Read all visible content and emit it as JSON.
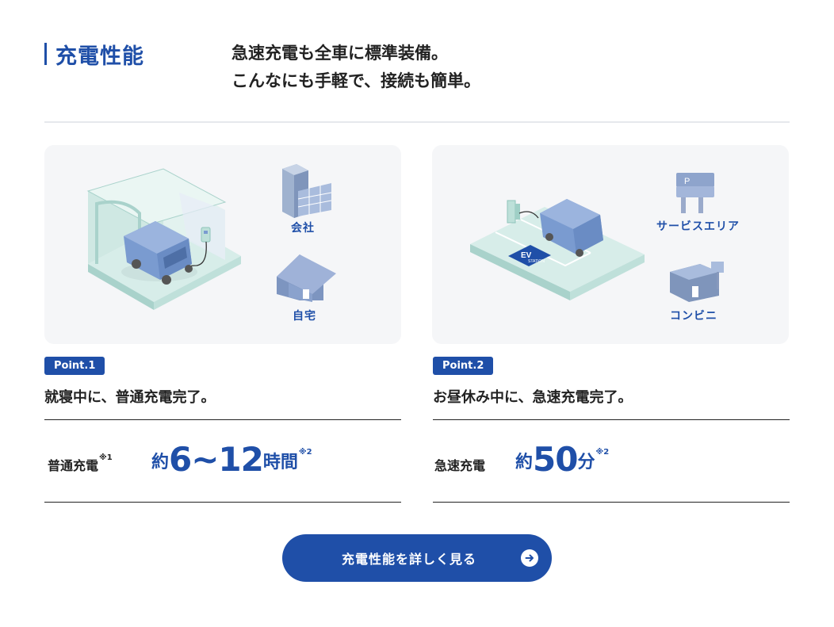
{
  "section": {
    "title": "充電性能",
    "lead_line1": "急速充電も全車に標準装備。",
    "lead_line2": "こんなにも手軽で、接続も簡単。"
  },
  "cards": [
    {
      "places": [
        "会社",
        "自宅"
      ],
      "point_badge": "Point.1",
      "description": "就寝中に、普通充電完了。",
      "charge_type": "普通充電",
      "charge_type_note": "※1",
      "value_prefix": "約",
      "value_number": "6~12",
      "value_unit": "時間",
      "value_note": "※2"
    },
    {
      "places": [
        "サービスエリア",
        "コンビニ"
      ],
      "point_badge": "Point.2",
      "description": "お昼休み中に、急速充電完了。",
      "charge_type": "急速充電",
      "charge_type_note": "",
      "value_prefix": "約",
      "value_number": "50",
      "value_unit": "分",
      "value_note": "※2"
    }
  ],
  "illustration_text": {
    "ev_sign": "EV",
    "ev_station": "STATION",
    "parking_sign": "P"
  },
  "cta": {
    "label": "充電性能を詳しく見る",
    "icon": "arrow-right-icon"
  },
  "colors": {
    "brand": "#1f4fa8",
    "card_bg": "#f5f6f8",
    "illustration_mint": "#c9e6e1",
    "car_blue": "#7a9bd0"
  }
}
